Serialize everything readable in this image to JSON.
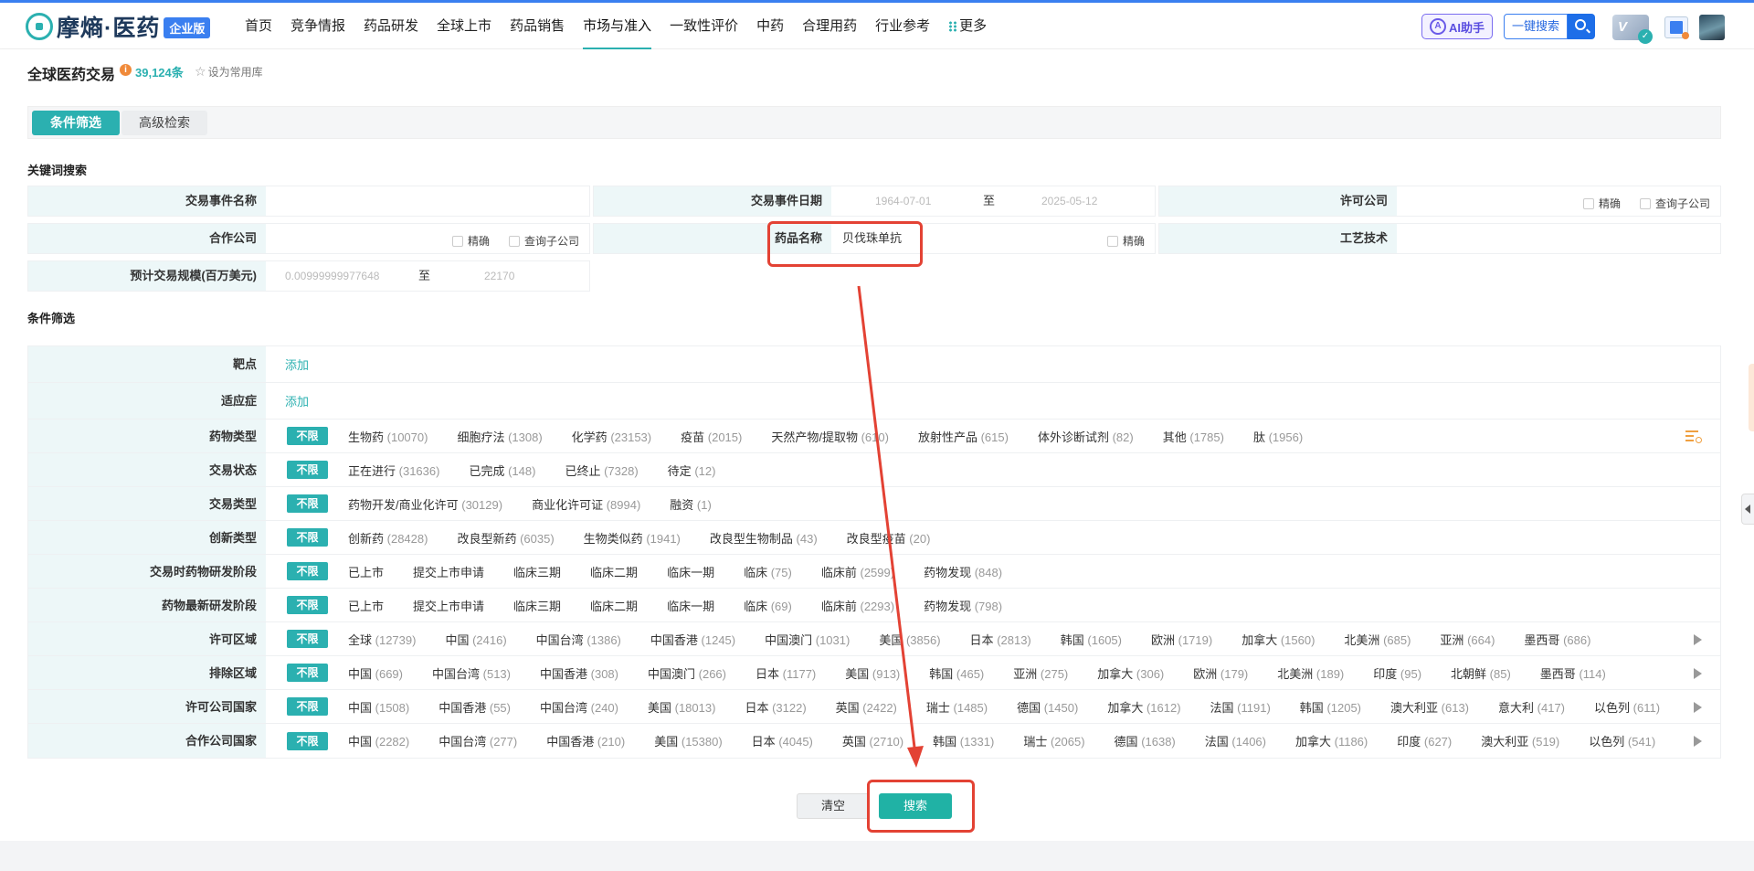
{
  "brand": {
    "name": "摩熵·医药",
    "edition": "企业版"
  },
  "nav": [
    {
      "label": "首页"
    },
    {
      "label": "竞争情报"
    },
    {
      "label": "药品研发"
    },
    {
      "label": "全球上市"
    },
    {
      "label": "药品销售"
    },
    {
      "label": "市场与准入"
    },
    {
      "label": "一致性评价"
    },
    {
      "label": "中药"
    },
    {
      "label": "合理用药"
    },
    {
      "label": "行业参考"
    },
    {
      "label": "更多"
    }
  ],
  "nav_active_index": 5,
  "header": {
    "ai_label": "AI助手",
    "quick_search_label": "一键搜索",
    "vip_label": "V"
  },
  "page": {
    "title": "全球医药交易",
    "count": "39,124条",
    "fav_label": "设为常用库"
  },
  "tabs": {
    "filter": "条件筛选",
    "advanced": "高级检索"
  },
  "keyword_section": {
    "title": "关键词搜索",
    "deal_name_label": "交易事件名称",
    "deal_date_label": "交易事件日期",
    "date_from_ph": "1964-07-01",
    "date_to_ph": "2025-05-12",
    "to_label": "至",
    "licensor_label": "许可公司",
    "partner_label": "合作公司",
    "drug_label": "药品名称",
    "drug_value": "贝伐珠单抗",
    "tech_label": "工艺技术",
    "scale_label": "预计交易规模(百万美元)",
    "scale_from_ph": "0.00999999977648",
    "scale_to_ph": "22170",
    "exact_label": "精确",
    "sub_label": "查询子公司"
  },
  "filter_section": {
    "title": "条件筛选",
    "add_label": "添加",
    "unlimited_label": "不限",
    "target_label": "靶点",
    "indication_label": "适应症",
    "rows": [
      {
        "label": "药物类型",
        "options": [
          {
            "name": "生物药",
            "count": "(10070)"
          },
          {
            "name": "细胞疗法",
            "count": "(1308)"
          },
          {
            "name": "化学药",
            "count": "(23153)"
          },
          {
            "name": "疫苗",
            "count": "(2015)"
          },
          {
            "name": "天然产物/提取物",
            "count": "(610)"
          },
          {
            "name": "放射性产品",
            "count": "(615)"
          },
          {
            "name": "体外诊断试剂",
            "count": "(82)"
          },
          {
            "name": "其他",
            "count": "(1785)"
          },
          {
            "name": "肽",
            "count": "(1956)"
          }
        ]
      },
      {
        "label": "交易状态",
        "options": [
          {
            "name": "正在进行",
            "count": "(31636)"
          },
          {
            "name": "已完成",
            "count": "(148)"
          },
          {
            "name": "已终止",
            "count": "(7328)"
          },
          {
            "name": "待定",
            "count": "(12)"
          }
        ]
      },
      {
        "label": "交易类型",
        "options": [
          {
            "name": "药物开发/商业化许可",
            "count": "(30129)"
          },
          {
            "name": "商业化许可证",
            "count": "(8994)"
          },
          {
            "name": "融资",
            "count": "(1)"
          }
        ]
      },
      {
        "label": "创新类型",
        "options": [
          {
            "name": "创新药",
            "count": "(28428)"
          },
          {
            "name": "改良型新药",
            "count": "(6035)"
          },
          {
            "name": "生物类似药",
            "count": "(1941)"
          },
          {
            "name": "改良型生物制品",
            "count": "(43)"
          },
          {
            "name": "改良型疫苗",
            "count": "(20)"
          }
        ]
      },
      {
        "label": "交易时药物研发阶段",
        "options": [
          {
            "name": "已上市",
            "count": ""
          },
          {
            "name": "提交上市申请",
            "count": ""
          },
          {
            "name": "临床三期",
            "count": ""
          },
          {
            "name": "临床二期",
            "count": ""
          },
          {
            "name": "临床一期",
            "count": ""
          },
          {
            "name": "临床",
            "count": "(75)"
          },
          {
            "name": "临床前",
            "count": "(2599)"
          },
          {
            "name": "药物发现",
            "count": "(848)"
          }
        ]
      },
      {
        "label": "药物最新研发阶段",
        "options": [
          {
            "name": "已上市",
            "count": ""
          },
          {
            "name": "提交上市申请",
            "count": ""
          },
          {
            "name": "临床三期",
            "count": ""
          },
          {
            "name": "临床二期",
            "count": ""
          },
          {
            "name": "临床一期",
            "count": ""
          },
          {
            "name": "临床",
            "count": "(69)"
          },
          {
            "name": "临床前",
            "count": "(2293)"
          },
          {
            "name": "药物发现",
            "count": "(798)"
          }
        ]
      },
      {
        "label": "许可区域",
        "options": [
          {
            "name": "全球",
            "count": "(12739)"
          },
          {
            "name": "中国",
            "count": "(2416)"
          },
          {
            "name": "中国台湾",
            "count": "(1386)"
          },
          {
            "name": "中国香港",
            "count": "(1245)"
          },
          {
            "name": "中国澳门",
            "count": "(1031)"
          },
          {
            "name": "美国",
            "count": "(3856)"
          },
          {
            "name": "日本",
            "count": "(2813)"
          },
          {
            "name": "韩国",
            "count": "(1605)"
          },
          {
            "name": "欧洲",
            "count": "(1719)"
          },
          {
            "name": "加拿大",
            "count": "(1560)"
          },
          {
            "name": "北美洲",
            "count": "(685)"
          },
          {
            "name": "亚洲",
            "count": "(664)"
          },
          {
            "name": "墨西哥",
            "count": "(686)"
          }
        ]
      },
      {
        "label": "排除区域",
        "options": [
          {
            "name": "中国",
            "count": "(669)"
          },
          {
            "name": "中国台湾",
            "count": "(513)"
          },
          {
            "name": "中国香港",
            "count": "(308)"
          },
          {
            "name": "中国澳门",
            "count": "(266)"
          },
          {
            "name": "日本",
            "count": "(1177)"
          },
          {
            "name": "美国",
            "count": "(913)"
          },
          {
            "name": "韩国",
            "count": "(465)"
          },
          {
            "name": "亚洲",
            "count": "(275)"
          },
          {
            "name": "加拿大",
            "count": "(306)"
          },
          {
            "name": "欧洲",
            "count": "(179)"
          },
          {
            "name": "北美洲",
            "count": "(189)"
          },
          {
            "name": "印度",
            "count": "(95)"
          },
          {
            "name": "北朝鲜",
            "count": "(85)"
          },
          {
            "name": "墨西哥",
            "count": "(114)"
          }
        ]
      },
      {
        "label": "许可公司国家",
        "options": [
          {
            "name": "中国",
            "count": "(1508)"
          },
          {
            "name": "中国香港",
            "count": "(55)"
          },
          {
            "name": "中国台湾",
            "count": "(240)"
          },
          {
            "name": "美国",
            "count": "(18013)"
          },
          {
            "name": "日本",
            "count": "(3122)"
          },
          {
            "name": "英国",
            "count": "(2422)"
          },
          {
            "name": "瑞士",
            "count": "(1485)"
          },
          {
            "name": "德国",
            "count": "(1450)"
          },
          {
            "name": "加拿大",
            "count": "(1612)"
          },
          {
            "name": "法国",
            "count": "(1191)"
          },
          {
            "name": "韩国",
            "count": "(1205)"
          },
          {
            "name": "澳大利亚",
            "count": "(613)"
          },
          {
            "name": "意大利",
            "count": "(417)"
          },
          {
            "name": "以色列",
            "count": "(611)"
          }
        ]
      },
      {
        "label": "合作公司国家",
        "options": [
          {
            "name": "中国",
            "count": "(2282)"
          },
          {
            "name": "中国台湾",
            "count": "(277)"
          },
          {
            "name": "中国香港",
            "count": "(210)"
          },
          {
            "name": "美国",
            "count": "(15380)"
          },
          {
            "name": "日本",
            "count": "(4045)"
          },
          {
            "name": "英国",
            "count": "(2710)"
          },
          {
            "name": "韩国",
            "count": "(1331)"
          },
          {
            "name": "瑞士",
            "count": "(2065)"
          },
          {
            "name": "德国",
            "count": "(1638)"
          },
          {
            "name": "法国",
            "count": "(1406)"
          },
          {
            "name": "加拿大",
            "count": "(1186)"
          },
          {
            "name": "印度",
            "count": "(627)"
          },
          {
            "name": "澳大利亚",
            "count": "(519)"
          },
          {
            "name": "以色列",
            "count": "(541)"
          }
        ]
      }
    ]
  },
  "actions": {
    "clear": "清空",
    "search": "搜索"
  },
  "annotation_color": "#e34234",
  "accent_color": "#2bb0b0"
}
